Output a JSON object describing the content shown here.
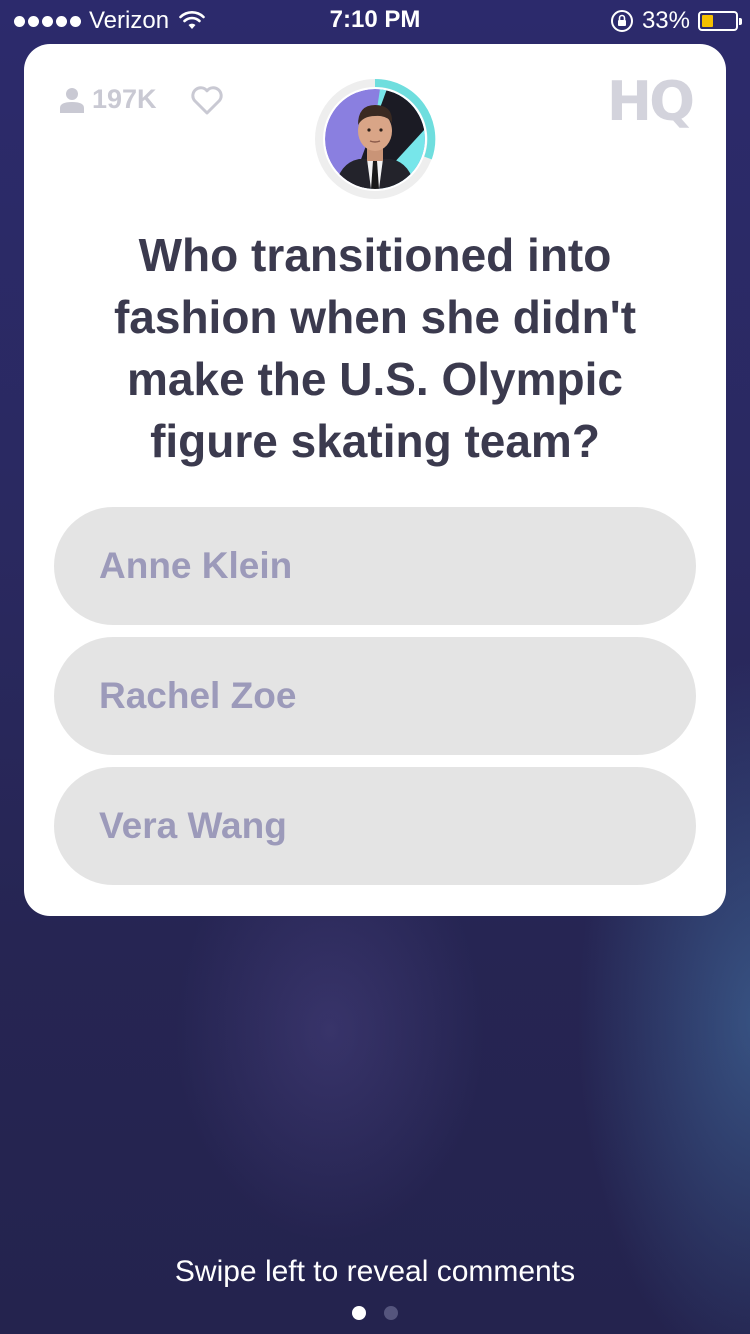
{
  "status_bar": {
    "carrier": "Verizon",
    "time": "7:10 PM",
    "battery_percent": "33%",
    "battery_level": 0.33,
    "battery_color": "#f5c000",
    "signal_bars": 5,
    "icons": [
      "signal-dots",
      "wifi-icon",
      "orientation-lock-icon",
      "battery-icon"
    ]
  },
  "card": {
    "viewer_count": "197K",
    "viewer_icon": "user-icon",
    "like_icon": "heart-icon",
    "logo_text": "HQ",
    "host_avatar": "host-avatar",
    "timer_color": "#6fdede",
    "question": "Who transitioned into fashion when she didn't make the U.S. Olympic figure skating team?",
    "answers": [
      {
        "label": "Anne Klein"
      },
      {
        "label": "Rachel Zoe"
      },
      {
        "label": "Vera Wang"
      }
    ]
  },
  "footer": {
    "swipe_hint": "Swipe left to reveal comments",
    "page_count": 2,
    "active_page": 1
  }
}
